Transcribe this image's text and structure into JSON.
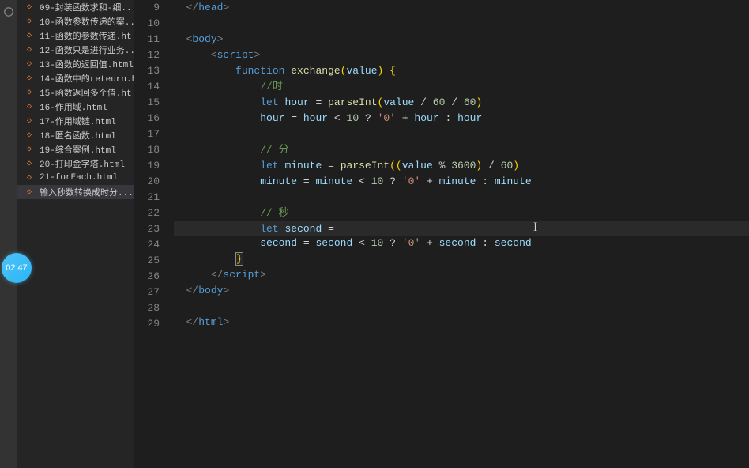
{
  "sidebar": {
    "files": [
      "09-封装函数求和-细..",
      "10-函数参数传递的案..",
      "11-函数的参数传递.ht..",
      "12-函数只是进行业务..",
      "13-函数的返回值.html",
      "14-函数中的reteurn.h..",
      "15-函数返回多个值.ht..",
      "16-作用域.html",
      "17-作用域链.html",
      "18-匿名函数.html",
      "19-综合案例.html",
      "20-打印金字塔.html",
      "21-forEach.html",
      "输入秒数转换成时分..."
    ],
    "activeIndex": 13
  },
  "editor": {
    "firstLine": 9,
    "lineCount": 21,
    "currentLine": 23,
    "tokens": {
      "head_close": "head",
      "body_open": "body",
      "body_close": "body",
      "html_close": "html",
      "script_open": "script",
      "script_close": "script",
      "kw_function": "function",
      "kw_let": "let",
      "fn_exchange": "exchange",
      "fn_parseInt": "parseInt",
      "param_value": "value",
      "var_hour": "hour",
      "var_minute": "minute",
      "var_second": "second",
      "num_60": "60",
      "num_10": "10",
      "num_3600": "3600",
      "str_zero": "'0'",
      "comment_hour": "//时",
      "comment_min": "// 分",
      "comment_sec": "// 秒"
    }
  },
  "badge": {
    "time": "02:47"
  }
}
